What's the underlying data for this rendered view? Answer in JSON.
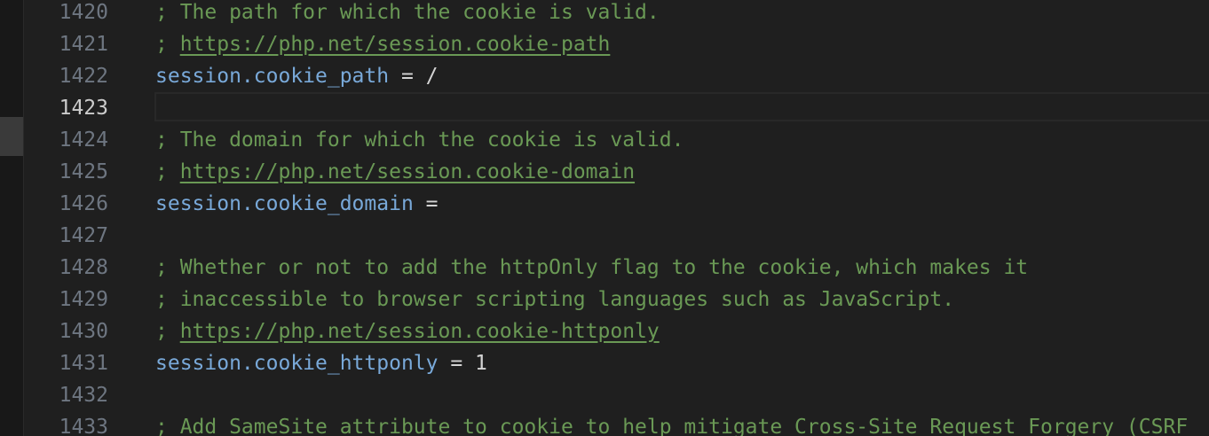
{
  "editor": {
    "current_line": "1423",
    "lines": [
      {
        "num": "1420",
        "parts": [
          {
            "t": "comment",
            "v": "; The path for which the cookie is valid."
          }
        ]
      },
      {
        "num": "1421",
        "parts": [
          {
            "t": "comment",
            "v": "; "
          },
          {
            "t": "link",
            "v": "https://php.net/session.cookie-path"
          }
        ]
      },
      {
        "num": "1422",
        "parts": [
          {
            "t": "key",
            "v": "session.cookie_path"
          },
          {
            "t": "op",
            "v": " = /"
          }
        ]
      },
      {
        "num": "1423",
        "parts": []
      },
      {
        "num": "1424",
        "parts": [
          {
            "t": "comment",
            "v": "; The domain for which the cookie is valid."
          }
        ]
      },
      {
        "num": "1425",
        "parts": [
          {
            "t": "comment",
            "v": "; "
          },
          {
            "t": "link",
            "v": "https://php.net/session.cookie-domain"
          }
        ]
      },
      {
        "num": "1426",
        "parts": [
          {
            "t": "key",
            "v": "session.cookie_domain"
          },
          {
            "t": "op",
            "v": " ="
          }
        ]
      },
      {
        "num": "1427",
        "parts": []
      },
      {
        "num": "1428",
        "parts": [
          {
            "t": "comment",
            "v": "; Whether or not to add the httpOnly flag to the cookie, which makes it"
          }
        ]
      },
      {
        "num": "1429",
        "parts": [
          {
            "t": "comment",
            "v": "; inaccessible to browser scripting languages such as JavaScript."
          }
        ]
      },
      {
        "num": "1430",
        "parts": [
          {
            "t": "comment",
            "v": "; "
          },
          {
            "t": "link",
            "v": "https://php.net/session.cookie-httponly"
          }
        ]
      },
      {
        "num": "1431",
        "parts": [
          {
            "t": "key",
            "v": "session.cookie_httponly"
          },
          {
            "t": "op",
            "v": " = 1"
          }
        ]
      },
      {
        "num": "1432",
        "parts": []
      },
      {
        "num": "1433",
        "parts": [
          {
            "t": "comment",
            "v": "; Add SameSite attribute to cookie to help mitigate Cross-Site Request Forgery (CSRF"
          }
        ]
      }
    ]
  },
  "colors": {
    "background": "#1f1f1f",
    "comment": "#6a9955",
    "key": "#79a9d9",
    "operator": "#d4d4d4",
    "line_number": "#6e7681",
    "line_number_current": "#cccccc"
  }
}
